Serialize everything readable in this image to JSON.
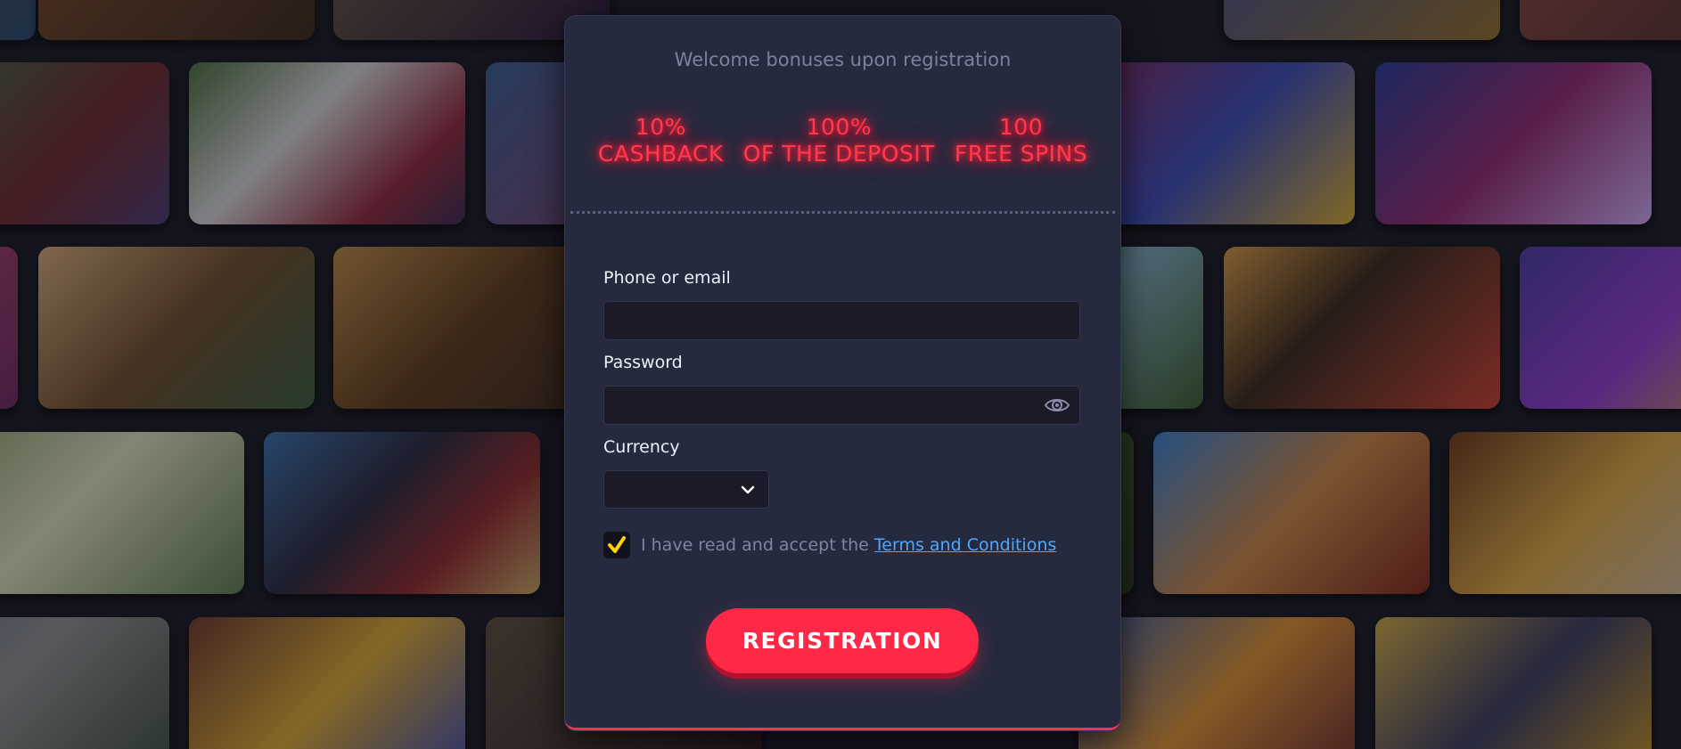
{
  "welcome": "Welcome bonuses upon registration",
  "bonuses": [
    {
      "value": "10%",
      "caption": "CASHBACK"
    },
    {
      "value": "100%",
      "caption": "OF THE DEPOSIT"
    },
    {
      "value": "100",
      "caption": "FREE SPINS"
    }
  ],
  "form": {
    "phone_label": "Phone or email",
    "phone_value": "",
    "password_label": "Password",
    "password_value": "",
    "currency_label": "Currency",
    "currency_value": "",
    "terms_prefix": "I have read and accept the ",
    "terms_link": "Terms and Conditions",
    "terms_checked": true,
    "submit_label": "REGISTRATION"
  },
  "icons": {
    "password_toggle": "eye-icon",
    "currency_dropdown": "chevron-down-icon",
    "checkbox": "checkmark-icon"
  },
  "colors": {
    "accent": "#ff2846",
    "neon": "#ff3a4c",
    "link": "#4ea6ff",
    "check": "#ffd400",
    "modal_bg": "#262a3f"
  }
}
